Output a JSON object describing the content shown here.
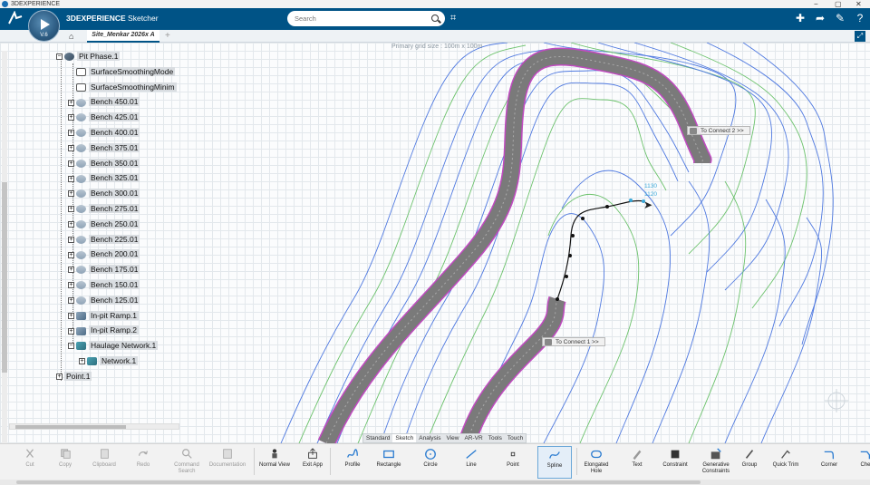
{
  "window": {
    "title": "3DEXPERIENCE",
    "minimize": "−",
    "restore": "▢",
    "close": "✕"
  },
  "topbar": {
    "brand_bold": "3DEXPERIENCE",
    "app": "Sketcher",
    "compass_version": "V.6",
    "search_placeholder": "Search",
    "icons": [
      "add-icon",
      "share-icon",
      "tools-icon",
      "help-icon"
    ]
  },
  "tabs": {
    "home_icon": "home-icon",
    "active_tab": "Site_Menkar 2026x A",
    "add_tab": "+"
  },
  "canvas": {
    "grid_label": "Primary grid size : 100m x 100m",
    "callout_1": "To Connect 2 >>",
    "callout_2": "To Connect 1 >>",
    "dim_1": "1130",
    "dim_2": "1120"
  },
  "tree": {
    "items": [
      {
        "label": "Pit Phase.1",
        "level": 0,
        "expand": "−",
        "icon": "pit-icon"
      },
      {
        "label": "SurfaceSmoothingMode",
        "level": 1,
        "expand": "",
        "icon": "parameter-icon"
      },
      {
        "label": "SurfaceSmoothingMinim",
        "level": 1,
        "expand": "",
        "icon": "parameter-icon"
      },
      {
        "label": "Bench 450.01",
        "level": 1,
        "expand": "+",
        "icon": "bench-icon"
      },
      {
        "label": "Bench 425.01",
        "level": 1,
        "expand": "+",
        "icon": "bench-icon"
      },
      {
        "label": "Bench 400.01",
        "level": 1,
        "expand": "+",
        "icon": "bench-icon"
      },
      {
        "label": "Bench 375.01",
        "level": 1,
        "expand": "+",
        "icon": "bench-icon"
      },
      {
        "label": "Bench 350.01",
        "level": 1,
        "expand": "+",
        "icon": "bench-icon"
      },
      {
        "label": "Bench 325.01",
        "level": 1,
        "expand": "+",
        "icon": "bench-icon"
      },
      {
        "label": "Bench 300.01",
        "level": 1,
        "expand": "+",
        "icon": "bench-icon"
      },
      {
        "label": "Bench 275.01",
        "level": 1,
        "expand": "+",
        "icon": "bench-icon"
      },
      {
        "label": "Bench 250.01",
        "level": 1,
        "expand": "+",
        "icon": "bench-icon"
      },
      {
        "label": "Bench 225.01",
        "level": 1,
        "expand": "+",
        "icon": "bench-icon"
      },
      {
        "label": "Bench 200.01",
        "level": 1,
        "expand": "+",
        "icon": "bench-icon"
      },
      {
        "label": "Bench 175.01",
        "level": 1,
        "expand": "+",
        "icon": "bench-icon"
      },
      {
        "label": "Bench 150.01",
        "level": 1,
        "expand": "+",
        "icon": "bench-icon"
      },
      {
        "label": "Bench 125.01",
        "level": 1,
        "expand": "+",
        "icon": "bench-icon"
      },
      {
        "label": "In-pit Ramp.1",
        "level": 1,
        "expand": "+",
        "icon": "ramp-icon"
      },
      {
        "label": "In-pit Ramp.2",
        "level": 1,
        "expand": "+",
        "icon": "ramp-icon"
      },
      {
        "label": "Haulage Network.1",
        "level": 1,
        "expand": "−",
        "icon": "network-icon"
      },
      {
        "label": "Network.1",
        "level": 2,
        "expand": "+",
        "icon": "network-icon"
      },
      {
        "label": "Point.1",
        "level": 0,
        "expand": "+",
        "icon": "point-icon"
      }
    ]
  },
  "context_tabs": [
    "Standard",
    "Sketch",
    "Analysis",
    "View",
    "AR-VR",
    "Tools",
    "Touch"
  ],
  "action_bar": [
    {
      "label": "Cut",
      "icon": "cut-icon",
      "enabled": false
    },
    {
      "label": "Copy",
      "icon": "copy-icon",
      "enabled": false
    },
    {
      "label": "Clipboard",
      "icon": "clipboard-icon",
      "enabled": false
    },
    {
      "label": "Redo",
      "icon": "redo-icon",
      "enabled": false
    },
    {
      "label": "Command Search",
      "icon": "command-search-icon",
      "enabled": false
    },
    {
      "label": "Documentation",
      "icon": "documentation-icon",
      "enabled": false
    },
    {
      "label": "Normal View",
      "icon": "normal-view-icon",
      "enabled": true
    },
    {
      "label": "Exit App",
      "icon": "exit-app-icon",
      "enabled": true
    },
    {
      "label": "Profile",
      "icon": "profile-icon",
      "enabled": true
    },
    {
      "label": "Rectangle",
      "icon": "rectangle-icon",
      "enabled": true
    },
    {
      "label": "Circle",
      "icon": "circle-icon",
      "enabled": true
    },
    {
      "label": "Line",
      "icon": "line-icon",
      "enabled": true
    },
    {
      "label": "Point",
      "icon": "point-icon",
      "enabled": true
    },
    {
      "label": "Spline",
      "icon": "spline-icon",
      "enabled": true,
      "selected": true
    },
    {
      "label": "Elongated Hole",
      "icon": "elongated-hole-icon",
      "enabled": true
    },
    {
      "label": "Text",
      "icon": "text-icon",
      "enabled": true
    },
    {
      "label": "Constraint",
      "icon": "constraint-icon",
      "enabled": true
    },
    {
      "label": "Generative Constraints",
      "icon": "generative-constraints-icon",
      "enabled": true
    },
    {
      "label": "Group",
      "icon": "group-icon",
      "enabled": true
    },
    {
      "label": "Quick Trim",
      "icon": "quick-trim-icon",
      "enabled": true
    },
    {
      "label": "Corner",
      "icon": "corner-icon",
      "enabled": true
    },
    {
      "label": "Che",
      "icon": "chamfer-icon",
      "enabled": true
    }
  ],
  "colors": {
    "brand_blue": "#005386",
    "contour_blue": "#4f79e0",
    "contour_green": "#6cc26c",
    "ramp_fill": "#6f6f6f",
    "ramp_edge": "#c04ac0"
  }
}
